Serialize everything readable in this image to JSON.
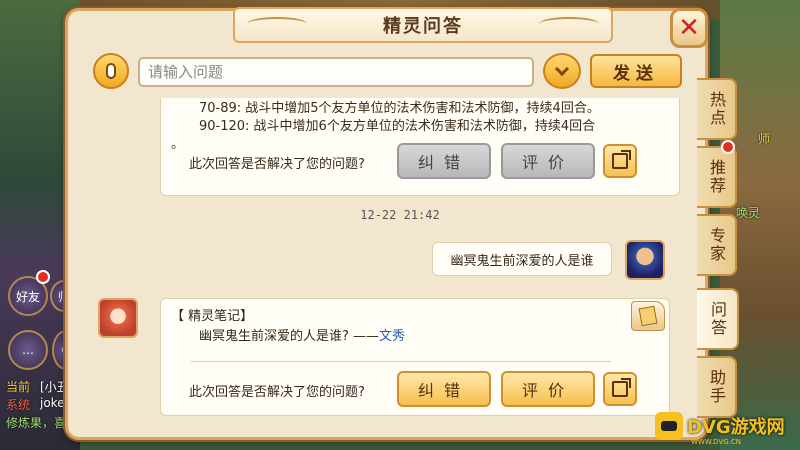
{
  "window": {
    "title": "精灵问答",
    "close_label": "✕"
  },
  "input": {
    "placeholder": "请输入问题",
    "value": "",
    "send_label": "发送"
  },
  "chat": {
    "card1": {
      "line1": "70-89:   战斗中增加5个友方单位的法术伤害和法术防御，持续4回合。",
      "line2": "90-120:   战斗中增加6个友方单位的法术伤害和法术防御，持续4回合",
      "line3": "。",
      "question": "此次回答是否解决了您的问题?",
      "correct_label": "纠错",
      "rate_label": "评价"
    },
    "timestamp": "12-22 21:42",
    "user_message": "幽冥鬼生前深爱的人是谁",
    "card2": {
      "title": "【 精灵笔记】",
      "answer_prefix": "幽冥鬼生前深爱的人是谁?   ——",
      "answer_link": "文秀",
      "question": "此次回答是否解决了您的问题?",
      "correct_label": "纠错",
      "rate_label": "评价"
    }
  },
  "tabs": [
    {
      "label": "热点"
    },
    {
      "label": "推荐"
    },
    {
      "label": "专家"
    },
    {
      "label": "问答"
    },
    {
      "label": "助手"
    }
  ],
  "background": {
    "friends": "好友",
    "mentor": "师",
    "current": "当前",
    "xiaochou": "[小丑",
    "system": "系统",
    "joker": "joker",
    "practice": "修炼果，喜",
    "spirit": "唤灵",
    "teacher": "师"
  },
  "watermark": {
    "text": "DVG游戏网",
    "sub": "WWW.DVG.CN"
  },
  "colors": {
    "panel_bg": "#f2e6cf",
    "gold": "#f5c050",
    "link": "#2a5ab0",
    "alert": "#e03020"
  }
}
